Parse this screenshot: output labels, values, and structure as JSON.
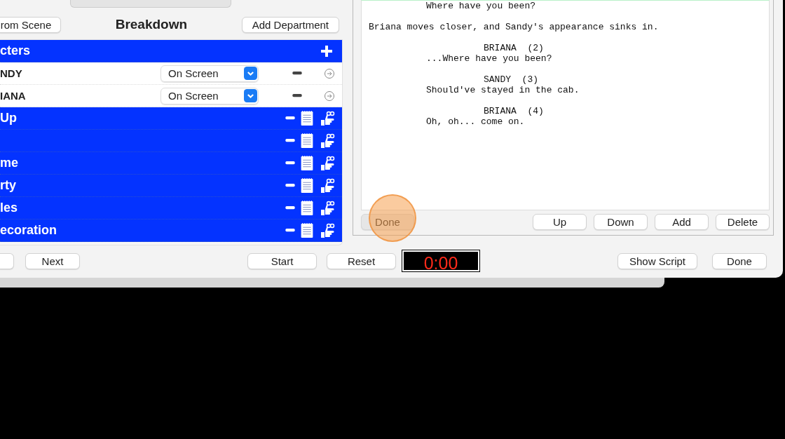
{
  "breakdown": {
    "from_scene_button": "rom Scene",
    "title": "Breakdown",
    "add_department_button": "Add Department",
    "sections": [
      {
        "kind": "characters",
        "label": "cters",
        "items": [
          {
            "name": "NDY",
            "status": "On Screen"
          },
          {
            "name": "IANA",
            "status": "On Screen"
          }
        ]
      },
      {
        "kind": "department",
        "label": "Up"
      },
      {
        "kind": "department"
      },
      {
        "kind": "department",
        "label": "me"
      },
      {
        "kind": "department",
        "label": "rty"
      },
      {
        "kind": "department",
        "label": "les"
      },
      {
        "kind": "department",
        "label": "ecoration"
      }
    ]
  },
  "script": {
    "lines": [
      {
        "kind": "dialogue",
        "text": "Where have you been?"
      },
      {
        "kind": "action",
        "text": "Briana moves closer, and Sandy's appearance sinks in."
      },
      {
        "kind": "character",
        "text": "BRIANA  (2)"
      },
      {
        "kind": "dialogue",
        "text": "...Where have you been?"
      },
      {
        "kind": "character",
        "text": "SANDY  (3)"
      },
      {
        "kind": "dialogue",
        "text": "Should've stayed in the cab."
      },
      {
        "kind": "character",
        "text": "BRIANA  (4)"
      },
      {
        "kind": "dialogue",
        "text": "Oh, oh... come on."
      }
    ],
    "done_button": "Done",
    "buttons": [
      "Up",
      "Down",
      "Add",
      "Delete"
    ]
  },
  "footer": {
    "next_button": "Next",
    "start_button": "Start",
    "reset_button": "Reset",
    "timer": "0:00",
    "show_script_button": "Show Script",
    "done_button": "Done"
  }
}
